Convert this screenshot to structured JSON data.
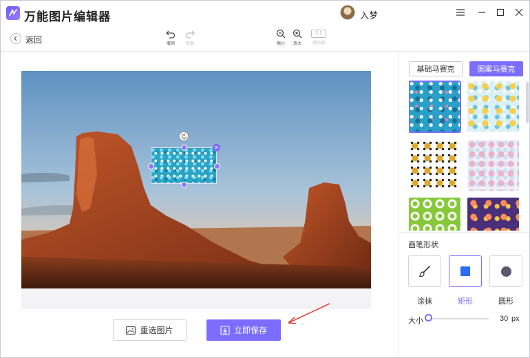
{
  "app": {
    "title": "万能图片编辑器",
    "username": "入梦",
    "accent": "#7b6dff"
  },
  "toolbar": {
    "back_label": "返回",
    "undo_label": "撤销",
    "redo_label": "恢复",
    "zoom_out_label": "缩小",
    "zoom_in_label": "放大",
    "ratio_text": "1:1",
    "ratio_label": "原比例"
  },
  "canvas": {
    "reselect_label": "重选图片",
    "save_label": "立即保存"
  },
  "panel": {
    "tabs": [
      {
        "label": "基础马赛克",
        "active": false
      },
      {
        "label": "图案马赛克",
        "active": true
      }
    ],
    "patterns": [
      {
        "icon": "ocean-pattern",
        "selected": true
      },
      {
        "icon": "baby-pattern",
        "selected": false
      },
      {
        "icon": "gift-pattern",
        "selected": false
      },
      {
        "icon": "dots-pattern",
        "selected": false
      },
      {
        "icon": "rings-pattern",
        "selected": false
      },
      {
        "icon": "confetti-pattern",
        "selected": false
      }
    ],
    "shape_section_title": "画笔形状",
    "shapes": [
      {
        "label": "涂抹",
        "icon": "brush-icon",
        "selected": false
      },
      {
        "label": "矩形",
        "icon": "square-icon",
        "selected": true
      },
      {
        "label": "圆形",
        "icon": "circle-icon",
        "selected": false
      }
    ],
    "size_label": "大小",
    "size_value": "30",
    "size_unit": "px",
    "size_fraction": 0.02
  }
}
